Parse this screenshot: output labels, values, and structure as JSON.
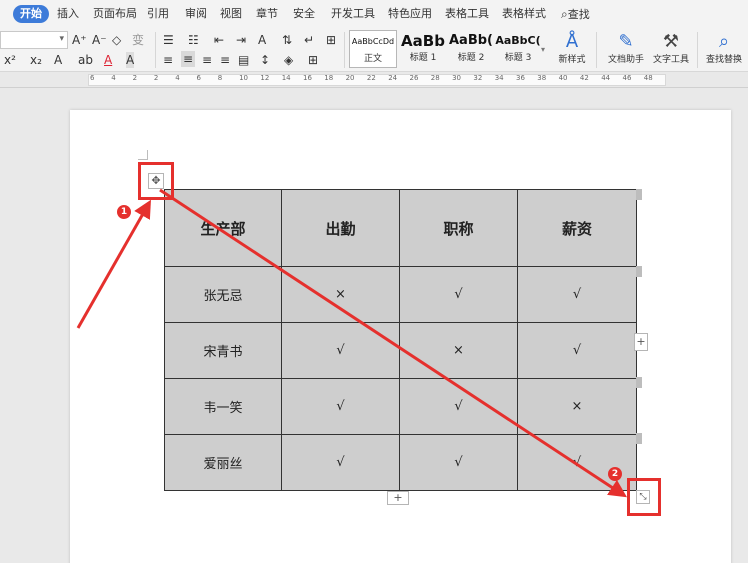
{
  "tabs": [
    "开始",
    "插入",
    "页面布局",
    "引用",
    "审阅",
    "视图",
    "章节",
    "安全",
    "开发工具",
    "特色应用",
    "表格工具",
    "表格样式",
    "查找"
  ],
  "search_icon": "magnifier-icon",
  "ribbon": {
    "font_name": "",
    "row1": [
      "A⁺",
      "A⁻",
      "◇",
      "变"
    ],
    "row2": [
      "x²",
      "x₂",
      "A",
      "ab",
      "A",
      "A"
    ],
    "styles": [
      {
        "sample": "AaBbCcDd",
        "name": "正文"
      },
      {
        "sample": "AaBb",
        "name": "标题 1"
      },
      {
        "sample": "AaBb(",
        "name": "标题 2"
      },
      {
        "sample": "AaBbC(",
        "name": "标题 3"
      }
    ],
    "new_style": "新样式",
    "doc_helper": "文档助手",
    "text_tools": "文字工具",
    "find_replace": "查找替换"
  },
  "ruler": [
    "6",
    "4",
    "2",
    "2",
    "4",
    "6",
    "8",
    "10",
    "12",
    "14",
    "16",
    "18",
    "20",
    "22",
    "24",
    "26",
    "28",
    "30",
    "32",
    "34",
    "36",
    "38",
    "40",
    "42",
    "44",
    "46",
    "48"
  ],
  "table": {
    "headers": [
      "生产部",
      "出勤",
      "职称",
      "薪资"
    ],
    "rows": [
      [
        "张无忌",
        "×",
        "√",
        "√"
      ],
      [
        "宋青书",
        "√",
        "×",
        "√"
      ],
      [
        "韦一笑",
        "√",
        "√",
        "×"
      ],
      [
        "爱丽丝",
        "√",
        "√",
        "√"
      ]
    ]
  },
  "handles": {
    "move": "✥",
    "resize": "⤡",
    "add": "+"
  },
  "annotations": {
    "badge1": "1",
    "badge2": "2",
    "color": "#e5302d"
  }
}
